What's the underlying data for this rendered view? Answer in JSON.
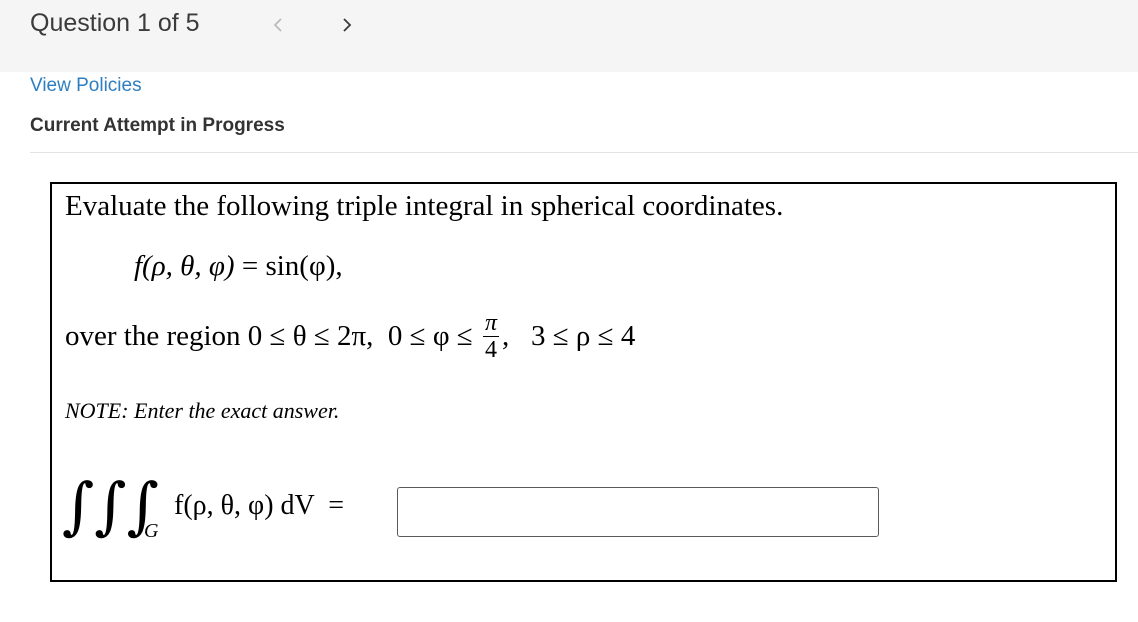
{
  "header": {
    "question_counter": "Question 1 of 5",
    "prev_icon": "chevron-left-icon",
    "next_icon": "chevron-right-icon",
    "prev_color": "#b8b8b8",
    "next_color": "#3b3b3b"
  },
  "links": {
    "view_policies": "View Policies"
  },
  "status": {
    "attempt": "Current Attempt in Progress"
  },
  "question": {
    "instruction": "Evaluate the following triple integral in spherical coordinates.",
    "function_lhs": "f(ρ, θ, φ)",
    "function_eq": " = ",
    "function_rhs": "sin(φ),",
    "region_prefix": "over the region 0 ≤ θ ≤ 2π,  0 ≤ φ ≤ ",
    "region_frac_num": "π",
    "region_frac_den": "4",
    "region_suffix": ",   3 ≤ ρ ≤ 4",
    "note": "NOTE: Enter the exact answer.",
    "integral_signs": "∫∫∫",
    "integral_subscript": "G",
    "integrand": "f(ρ, θ, φ) dV  =",
    "answer_value": "",
    "answer_placeholder": ""
  },
  "colors": {
    "link": "#2d7fc1",
    "topbar_bg": "#f5f5f5",
    "text": "#333333",
    "box_border": "#000000"
  }
}
